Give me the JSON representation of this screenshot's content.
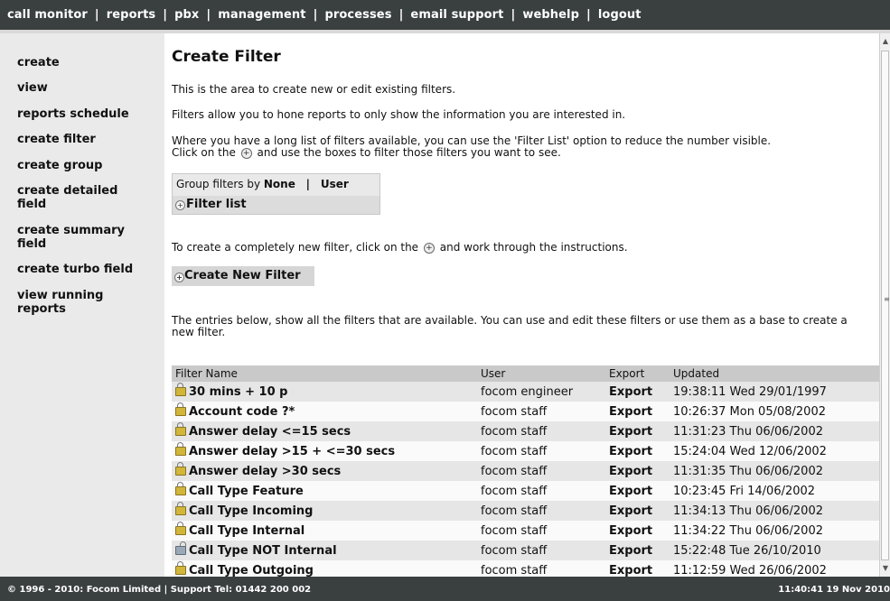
{
  "topnav": {
    "items": [
      "call monitor",
      "reports",
      "pbx",
      "management",
      "processes",
      "email support",
      "webhelp",
      "logout"
    ]
  },
  "sidebar": {
    "items": [
      {
        "label": "create"
      },
      {
        "label": "view"
      },
      {
        "label": "reports schedule"
      },
      {
        "label": "create filter"
      },
      {
        "label": "create group"
      },
      {
        "label": "create detailed field"
      },
      {
        "label": "create summary field"
      },
      {
        "label": "create turbo field"
      },
      {
        "label": "view running reports"
      }
    ]
  },
  "main": {
    "title": "Create Filter",
    "intro1": "This is the area to create new or edit existing filters.",
    "intro2": "Filters allow you to hone reports to only show the information you are interested in.",
    "intro3a": "Where you have a long list of filters available, you can use the 'Filter List' option to reduce the number visible.",
    "intro3b_pre": "Click on the",
    "intro3b_post": "and use the boxes to filter those filters you want to see.",
    "group_label": "Group filters by",
    "group_none": "None",
    "group_sep": "|",
    "group_user": "User",
    "filter_list": "Filter list",
    "create_text_pre": "To create a completely new filter, click on the",
    "create_text_post": "and work through the instructions.",
    "create_button": "Create New Filter",
    "entries_text": "The entries below, show all the filters that are available. You can use and edit these filters or use them as a base to create a new filter."
  },
  "table": {
    "headers": {
      "name": "Filter Name",
      "user": "User",
      "export": "Export",
      "updated": "Updated"
    },
    "rows": [
      {
        "name": "30 mins + 10 p",
        "user": "focom engineer",
        "export": "Export",
        "updated": "19:38:11 Wed 29/01/1997",
        "lock": "closed"
      },
      {
        "name": "Account code ?*",
        "user": "focom staff",
        "export": "Export",
        "updated": "10:26:37 Mon 05/08/2002",
        "lock": "closed"
      },
      {
        "name": "Answer delay <=15 secs",
        "user": "focom staff",
        "export": "Export",
        "updated": "11:31:23 Thu 06/06/2002",
        "lock": "closed"
      },
      {
        "name": "Answer delay >15 + <=30 secs",
        "user": "focom staff",
        "export": "Export",
        "updated": "15:24:04 Wed 12/06/2002",
        "lock": "closed"
      },
      {
        "name": "Answer delay >30 secs",
        "user": "focom staff",
        "export": "Export",
        "updated": "11:31:35 Thu 06/06/2002",
        "lock": "closed"
      },
      {
        "name": "Call Type Feature",
        "user": "focom staff",
        "export": "Export",
        "updated": "10:23:45 Fri 14/06/2002",
        "lock": "closed"
      },
      {
        "name": "Call Type Incoming",
        "user": "focom staff",
        "export": "Export",
        "updated": "11:34:13 Thu 06/06/2002",
        "lock": "closed"
      },
      {
        "name": "Call Type Internal",
        "user": "focom staff",
        "export": "Export",
        "updated": "11:34:22 Thu 06/06/2002",
        "lock": "closed"
      },
      {
        "name": "Call Type NOT Internal",
        "user": "focom staff",
        "export": "Export",
        "updated": "15:22:48 Tue 26/10/2010",
        "lock": "open"
      },
      {
        "name": "Call Type Outgoing",
        "user": "focom staff",
        "export": "Export",
        "updated": "11:12:59 Wed 26/06/2002",
        "lock": "closed"
      }
    ]
  },
  "footer": {
    "left": "© 1996 - 2010: Focom Limited | Support Tel: 01442 200 002",
    "right": "11:40:41 19 Nov 2010"
  },
  "colors": {
    "topbar": "#3a3f3f",
    "sidebar": "#eaeaea",
    "table_header": "#c9c9c9",
    "row_odd": "#e6e6e6",
    "lock_closed": "#d2b63a"
  }
}
